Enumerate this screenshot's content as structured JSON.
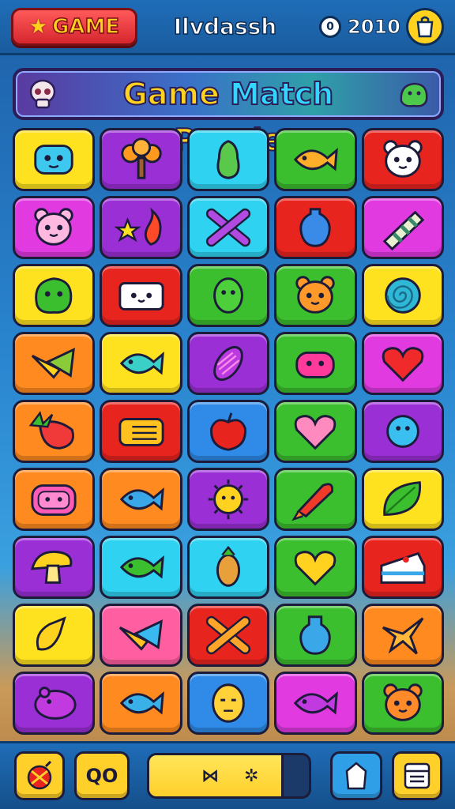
{
  "header": {
    "game_button_label": "GAME",
    "title": "Ilvdassh",
    "coins": "2010",
    "coin_icon": "coin-icon",
    "shop_icon": "bag-icon"
  },
  "banner": {
    "title_word_1": "Game",
    "title_word_2": "Match",
    "title_word_3": "Puzzle"
  },
  "colors": {
    "yellow": "#ffe21f",
    "purple": "#9b2fd6",
    "cyan": "#2fd2f0",
    "green": "#3cbf2e",
    "red": "#e8241f",
    "magenta": "#e03ae0",
    "pink": "#ff5fa0",
    "orange": "#ff8a1f",
    "blue": "#2f8ae8"
  },
  "board": {
    "rows": 9,
    "cols": 5,
    "tiles": [
      {
        "icon": "blue-robot-face",
        "bg": "yellow"
      },
      {
        "icon": "orange-tree",
        "bg": "purple"
      },
      {
        "icon": "green-pear",
        "bg": "cyan"
      },
      {
        "icon": "orange-fish",
        "bg": "green"
      },
      {
        "icon": "white-bear-face",
        "bg": "red"
      },
      {
        "icon": "pink-pig-face",
        "bg": "magenta"
      },
      {
        "icon": "star-and-flame",
        "bg": "purple"
      },
      {
        "icon": "crossed-sticks",
        "bg": "cyan"
      },
      {
        "icon": "blue-vase",
        "bg": "red"
      },
      {
        "icon": "striped-candy",
        "bg": "magenta"
      },
      {
        "icon": "green-blob-face",
        "bg": "yellow"
      },
      {
        "icon": "white-box-face",
        "bg": "red"
      },
      {
        "icon": "green-alien-face",
        "bg": "green"
      },
      {
        "icon": "orange-cat-face",
        "bg": "green"
      },
      {
        "icon": "teal-spiral",
        "bg": "yellow"
      },
      {
        "icon": "yellow-bird",
        "bg": "orange"
      },
      {
        "icon": "teal-fish",
        "bg": "yellow"
      },
      {
        "icon": "purple-corn",
        "bg": "purple"
      },
      {
        "icon": "pink-crab",
        "bg": "green"
      },
      {
        "icon": "red-heart",
        "bg": "magenta"
      },
      {
        "icon": "strawberry",
        "bg": "orange"
      },
      {
        "icon": "yellow-radio",
        "bg": "red"
      },
      {
        "icon": "red-apple",
        "bg": "blue"
      },
      {
        "icon": "pink-heart",
        "bg": "green"
      },
      {
        "icon": "blue-pufferfish",
        "bg": "purple"
      },
      {
        "icon": "pink-tv-face",
        "bg": "orange"
      },
      {
        "icon": "blue-fish",
        "bg": "orange"
      },
      {
        "icon": "sun-face",
        "bg": "purple"
      },
      {
        "icon": "red-rocket",
        "bg": "green"
      },
      {
        "icon": "green-leaf",
        "bg": "yellow"
      },
      {
        "icon": "yellow-mushroom",
        "bg": "purple"
      },
      {
        "icon": "green-fish",
        "bg": "cyan"
      },
      {
        "icon": "orange-pinecone",
        "bg": "cyan"
      },
      {
        "icon": "yellow-heart",
        "bg": "green"
      },
      {
        "icon": "cake-slice",
        "bg": "red"
      },
      {
        "icon": "yellow-rocket",
        "bg": "yellow"
      },
      {
        "icon": "orange-bird",
        "bg": "pink"
      },
      {
        "icon": "crossed-bones",
        "bg": "red"
      },
      {
        "icon": "blue-bottle",
        "bg": "green"
      },
      {
        "icon": "orange-plane",
        "bg": "orange"
      },
      {
        "icon": "purple-hippo",
        "bg": "purple"
      },
      {
        "icon": "blue-whale",
        "bg": "orange"
      },
      {
        "icon": "yellow-mask-face",
        "bg": "blue"
      },
      {
        "icon": "purple-fish",
        "bg": "magenta"
      },
      {
        "icon": "orange-bear-face",
        "bg": "green"
      }
    ]
  },
  "footer": {
    "left_icon": "bomb-icon",
    "counter_label": "QO",
    "progress_fraction": 0.84,
    "progress_icon_1": "⋈",
    "progress_icon_2": "✲",
    "bag_icon": "backpack-icon",
    "menu_icon": "menu-box-icon"
  }
}
